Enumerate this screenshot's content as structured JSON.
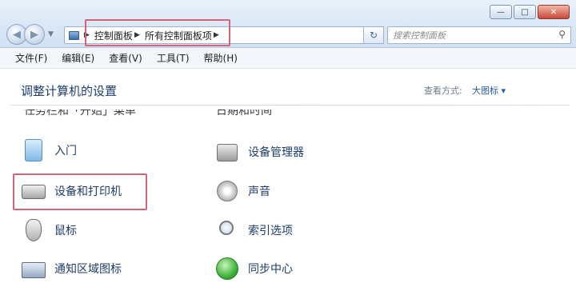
{
  "window": {
    "controls": [
      "minimize",
      "maximize",
      "close"
    ]
  },
  "address": {
    "crumbs": [
      "控制面板",
      "所有控制面板项"
    ]
  },
  "search": {
    "placeholder": "搜索控制面板"
  },
  "menu": [
    "文件(F)",
    "编辑(E)",
    "查看(V)",
    "工具(T)",
    "帮助(H)"
  ],
  "content": {
    "heading": "调整计算机的设置",
    "viewby_label": "查看方式:",
    "viewby_value": "大图标 ▾",
    "cutoff_left": "任务栏和「开始」菜单",
    "cutoff_right": "日期和时间",
    "items_left": [
      {
        "label": "入门",
        "icon": "getting-started-icon"
      },
      {
        "label": "设备和打印机",
        "icon": "printer-icon"
      },
      {
        "label": "鼠标",
        "icon": "mouse-icon"
      },
      {
        "label": "通知区域图标",
        "icon": "notification-area-icon"
      }
    ],
    "items_right": [
      {
        "label": "设备管理器",
        "icon": "device-manager-icon"
      },
      {
        "label": "声音",
        "icon": "sound-icon"
      },
      {
        "label": "索引选项",
        "icon": "indexing-options-icon"
      },
      {
        "label": "同步中心",
        "icon": "sync-center-icon"
      }
    ]
  },
  "colors": {
    "highlight": "#d2657a",
    "link": "#1d3e6e"
  }
}
